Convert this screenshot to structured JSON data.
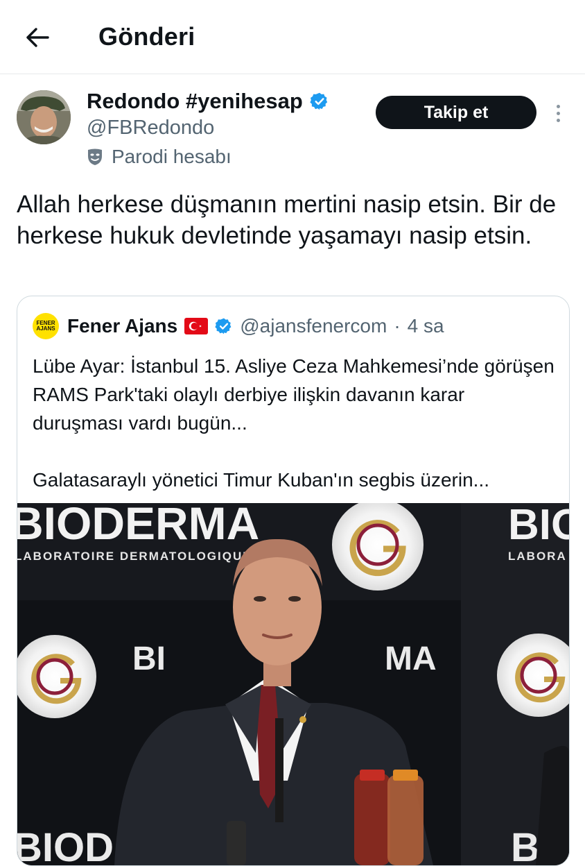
{
  "header": {
    "title": "Gönderi",
    "back_icon": "arrow-left-icon"
  },
  "author": {
    "display_name": "Redondo #yenihesap",
    "handle": "@FBRedondo",
    "verified_icon": "verified-badge-icon",
    "parody_label": "Parodi hesabı",
    "parody_icon": "mask-icon"
  },
  "actions": {
    "follow_label": "Takip et",
    "more_icon": "more-vertical-icon"
  },
  "tweet": {
    "text": "Allah herkese düşmanın mertini nasip etsin. Bir de herkese hukuk devletinde yaşamayı nasip etsin."
  },
  "quote": {
    "display_name": "Fener Ajans",
    "flag_icon": "turkey-flag-icon",
    "verified_icon": "verified-badge-icon",
    "handle": "@ajansfenercom",
    "separator": "·",
    "time": "4 sa",
    "logo_text_top": "FENER",
    "logo_text_bottom": "AJANS",
    "paragraph1": "Lübe Ayar: İstanbul 15. Asliye Ceza Mahkemesi’nde görüşen RAMS Park'taki olaylı derbiye ilişkin davanın karar duruşması vardı bugün...",
    "paragraph2": "Galatasaraylı yönetici Timur Kuban'ın segbis üzerin...",
    "media": {
      "banner_text_left": "BIODERMA",
      "banner_sub_left": "LABORATOIRE DERMATOLOGIQUE",
      "banner_text_right": "BIO",
      "banner_sub_right": "LABORA",
      "banner_text_mid": "BI",
      "banner_text_mid2": "MA",
      "banner_text_bottom": "BIOD",
      "banner_text_bottom_right": "BIO"
    }
  },
  "colors": {
    "text": "#0f1419",
    "secondary": "#536471",
    "verified": "#1d9bf0",
    "border": "#cfd9de",
    "button": "#0f1419"
  }
}
